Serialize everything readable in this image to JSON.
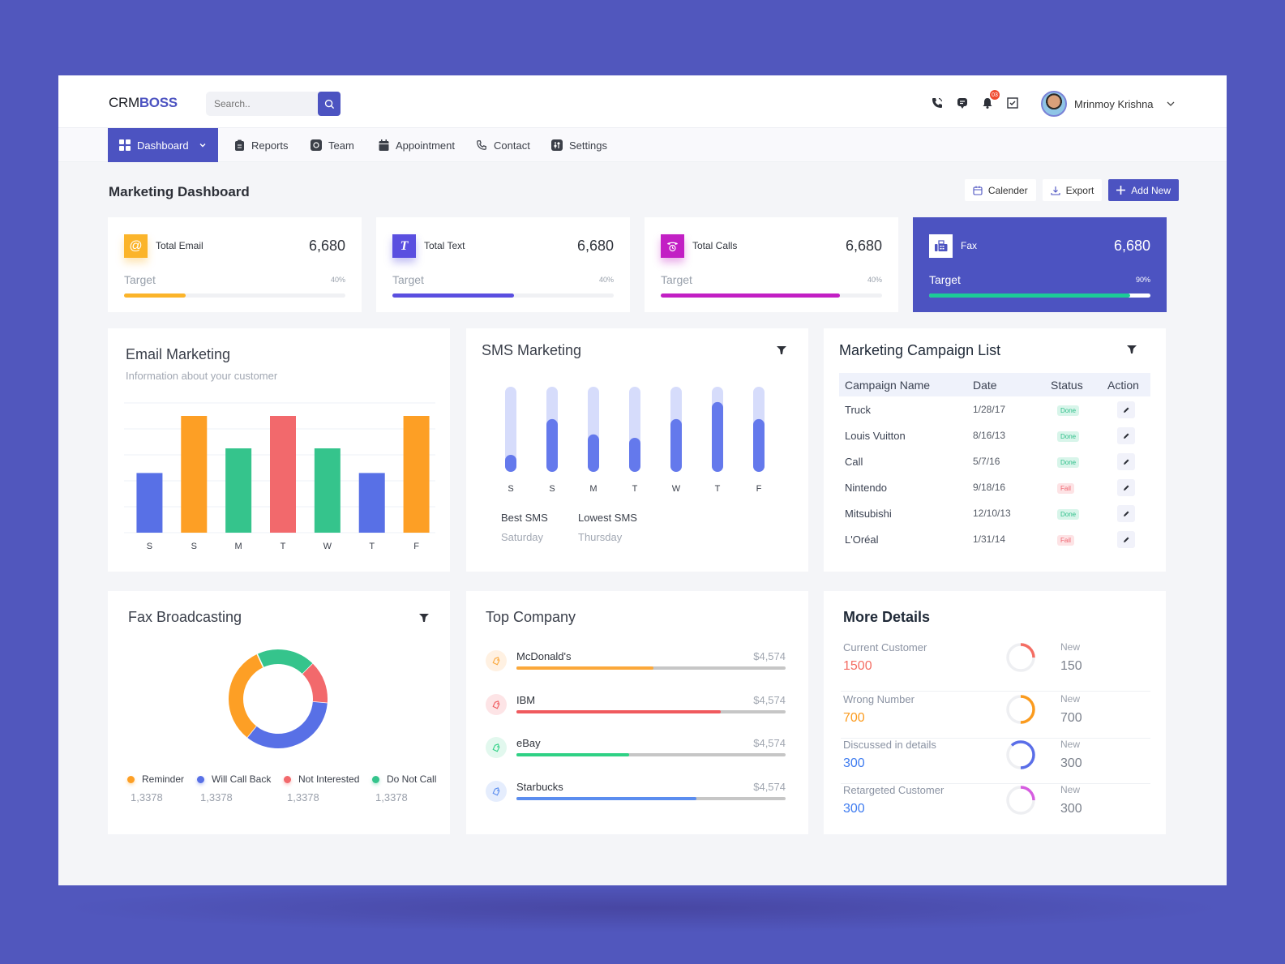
{
  "app": {
    "logo_prefix": "CRM",
    "logo_suffix": "BOSS"
  },
  "search": {
    "placeholder": "Search.."
  },
  "header": {
    "notification_count": "03",
    "user_name": "Mrinmoy Krishna"
  },
  "nav": [
    {
      "label": "Dashboard",
      "icon": "grid-icon",
      "active": true
    },
    {
      "label": "Reports",
      "icon": "clipboard-icon"
    },
    {
      "label": "Team",
      "icon": "team-icon"
    },
    {
      "label": "Appointment",
      "icon": "calendar-icon"
    },
    {
      "label": "Contact",
      "icon": "phone-icon"
    },
    {
      "label": "Settings",
      "icon": "settings-icon"
    }
  ],
  "page": {
    "title": "Marketing Dashboard",
    "actions": {
      "calendar": "Calender",
      "export": "Export",
      "add_new": "Add New"
    }
  },
  "kpis": [
    {
      "label": "Total Email",
      "value": "6,680",
      "target_label": "Target",
      "percent_label": "40%",
      "progress": 0.28,
      "color": "#fbb42a",
      "icon": "at-icon"
    },
    {
      "label": "Total Text",
      "value": "6,680",
      "target_label": "Target",
      "percent_label": "40%",
      "progress": 0.55,
      "color": "#5a4fe0",
      "icon": "text-icon"
    },
    {
      "label": "Total Calls",
      "value": "6,680",
      "target_label": "Target",
      "percent_label": "40%",
      "progress": 0.81,
      "color": "#c21fc4",
      "icon": "phone-clock-icon"
    },
    {
      "label": "Fax",
      "value": "6,680",
      "target_label": "Target",
      "percent_label": "90%",
      "progress": 0.91,
      "color": "#1ccb97",
      "icon": "fax-icon"
    }
  ],
  "email_marketing": {
    "title": "Email Marketing",
    "subtitle": "Information about your customer"
  },
  "sms_marketing": {
    "title": "SMS Marketing",
    "best_label": "Best SMS",
    "best_value": "Saturday",
    "lowest_label": "Lowest SMS",
    "lowest_value": "Thursday"
  },
  "campaigns": {
    "title": "Marketing Campaign List",
    "columns": [
      "Campaign Name",
      "Date",
      "Status",
      "Action"
    ],
    "rows": [
      {
        "name": "Truck",
        "date": "1/28/17",
        "status": "Done"
      },
      {
        "name": "Louis Vuitton",
        "date": "8/16/13",
        "status": "Done"
      },
      {
        "name": "Call",
        "date": "5/7/16",
        "status": "Done"
      },
      {
        "name": "Nintendo",
        "date": "9/18/16",
        "status": "Fail"
      },
      {
        "name": "Mitsubishi",
        "date": "12/10/13",
        "status": "Done"
      },
      {
        "name": "L'Oréal",
        "date": "1/31/14",
        "status": "Fail"
      }
    ]
  },
  "fax_broadcasting": {
    "title": "Fax Broadcasting"
  },
  "top_company": {
    "title": "Top Company",
    "items": [
      {
        "name": "McDonald's",
        "value": "$4,574",
        "progress": 0.51,
        "color": "#fba83a",
        "bg": "#fff1e2"
      },
      {
        "name": "IBM",
        "value": "$4,574",
        "progress": 0.76,
        "color": "#f05a5e",
        "bg": "#fde4e6"
      },
      {
        "name": "eBay",
        "value": "$4,574",
        "progress": 0.42,
        "color": "#2fd185",
        "bg": "#e2f8ee"
      },
      {
        "name": "Starbucks",
        "value": "$4,574",
        "progress": 0.67,
        "color": "#5b8def",
        "bg": "#e5edfd"
      }
    ]
  },
  "more_details": {
    "title": "More Details",
    "rows": [
      {
        "label": "Current Customer",
        "value": "1500",
        "new_label": "New",
        "new_value": "150",
        "color": "#f46d63",
        "progress": 0.25
      },
      {
        "label": "Wrong Number",
        "value": "700",
        "new_label": "New",
        "new_value": "700",
        "color": "#fb9b1e",
        "progress": 0.5
      },
      {
        "label": "Discussed in details",
        "value": "300",
        "new_label": "New",
        "new_value": "300",
        "color": "#5a6ee8",
        "progress": 0.62
      },
      {
        "label": "Retargeted Customer",
        "value": "300",
        "new_label": "New",
        "new_value": "300",
        "color": "#d65de0",
        "progress": 0.25
      }
    ]
  },
  "chart_data": [
    {
      "type": "bar",
      "title": "Email Marketing",
      "subtitle": "Information about your customer",
      "categories": [
        "S",
        "S",
        "M",
        "T",
        "W",
        "T",
        "F"
      ],
      "values": [
        46,
        90,
        65,
        90,
        65,
        46,
        90
      ],
      "colors": [
        "#5870e6",
        "#fd9f25",
        "#35c48c",
        "#f2696c",
        "#35c48c",
        "#5870e6",
        "#fd9f25"
      ],
      "ylim": [
        0,
        100
      ],
      "grid": true,
      "xlabel": "",
      "ylabel": ""
    },
    {
      "type": "bar",
      "title": "SMS Marketing",
      "categories": [
        "S",
        "S",
        "M",
        "T",
        "W",
        "T",
        "F"
      ],
      "values": [
        20,
        62,
        44,
        40,
        62,
        82,
        62
      ],
      "ylim": [
        0,
        100
      ],
      "grid": false
    },
    {
      "type": "pie",
      "title": "Fax Broadcasting",
      "donut": true,
      "labels": [
        "Reminder",
        "Will Call Back",
        "Not Interested",
        "Do Not Call"
      ],
      "values": [
        30,
        32,
        13,
        18
      ],
      "value_labels": [
        "1,3378",
        "1,3378",
        "1,3378",
        "1,3378"
      ],
      "colors": [
        "#fd9f25",
        "#5870e6",
        "#f2696c",
        "#35c48c"
      ],
      "legend": "bottom"
    }
  ]
}
